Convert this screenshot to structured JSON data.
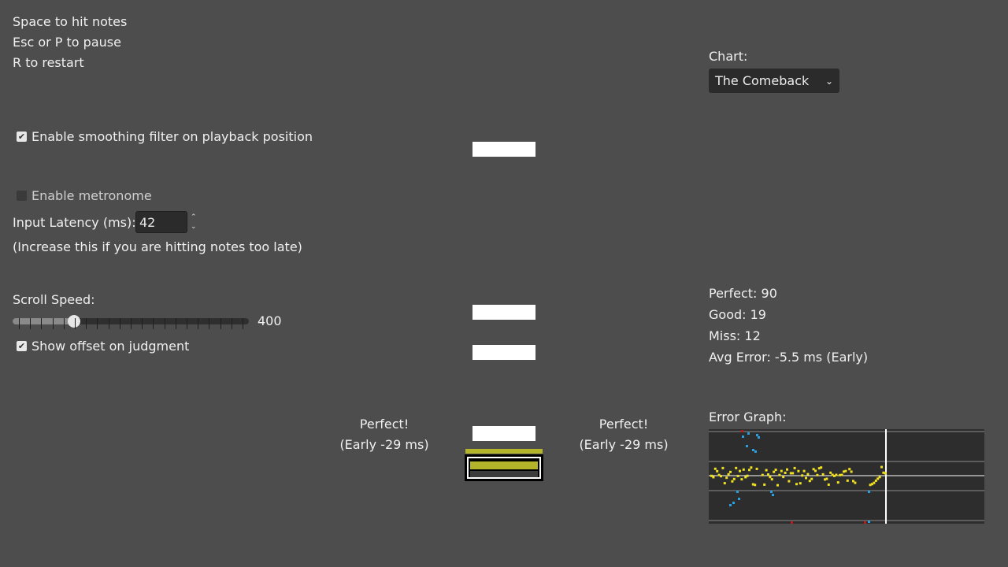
{
  "instructions": [
    "Space to hit notes",
    "Esc or P to pause",
    "R to restart"
  ],
  "options": {
    "smoothing_label": "Enable smoothing filter on playback position",
    "smoothing_checked": true,
    "metronome_label": "Enable metronome",
    "metronome_checked": false,
    "latency_label": "Input Latency (ms):",
    "latency_value": "42",
    "latency_hint": "(Increase this if you are hitting notes too late)",
    "scroll_label": "Scroll Speed:",
    "scroll_value": "400",
    "scroll_fraction": 0.26,
    "offset_label": "Show offset on judgment",
    "offset_checked": true
  },
  "chart_select": {
    "label": "Chart:",
    "selected": "The Comeback"
  },
  "judgment_left": {
    "line1": "Perfect!",
    "line2": "(Early -29 ms)"
  },
  "judgment_right": {
    "line1": "Perfect!",
    "line2": "(Early -29 ms)"
  },
  "stats": {
    "perfect": "Perfect: 90",
    "good": "Good: 19",
    "miss": "Miss: 12",
    "avg_error": "Avg Error: -5.5 ms (Early)"
  },
  "error_graph": {
    "label": "Error Graph:"
  },
  "colors": {
    "background": "#4d4d4d",
    "note": "#ffffff",
    "receptor": "#b4b42a",
    "graph_perfect": "#f0e020",
    "graph_good": "#2aa0e0",
    "graph_miss": "#c01818"
  }
}
